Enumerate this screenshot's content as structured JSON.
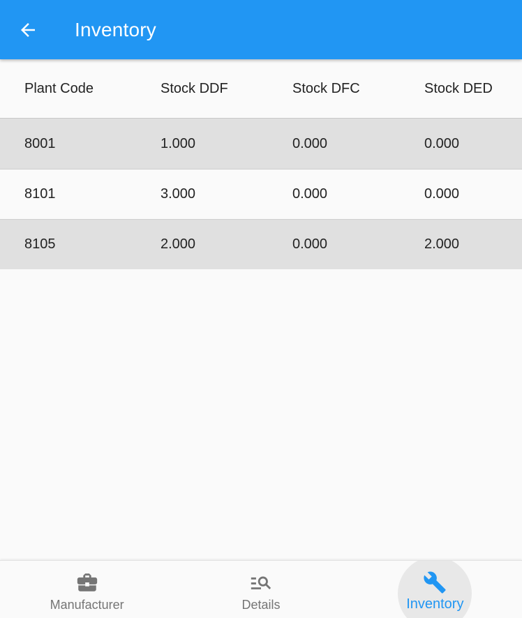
{
  "appbar": {
    "title": "Inventory"
  },
  "table": {
    "headers": [
      "Plant Code",
      "Stock DDF",
      "Stock DFC",
      "Stock DED"
    ],
    "rows": [
      [
        "8001",
        "1.000",
        "0.000",
        "0.000"
      ],
      [
        "8101",
        "3.000",
        "0.000",
        "0.000"
      ],
      [
        "8105",
        "2.000",
        "0.000",
        "2.000"
      ]
    ]
  },
  "bottom_nav": {
    "items": [
      {
        "label": "Manufacturer",
        "icon": "briefcase-icon"
      },
      {
        "label": "Details",
        "icon": "manage-search-icon"
      },
      {
        "label": "Inventory",
        "icon": "wrench-icon"
      }
    ],
    "active": "Inventory"
  },
  "colors": {
    "primary": "#2196f3",
    "row_shade": "#e0e0e0",
    "inactive": "#757575"
  }
}
